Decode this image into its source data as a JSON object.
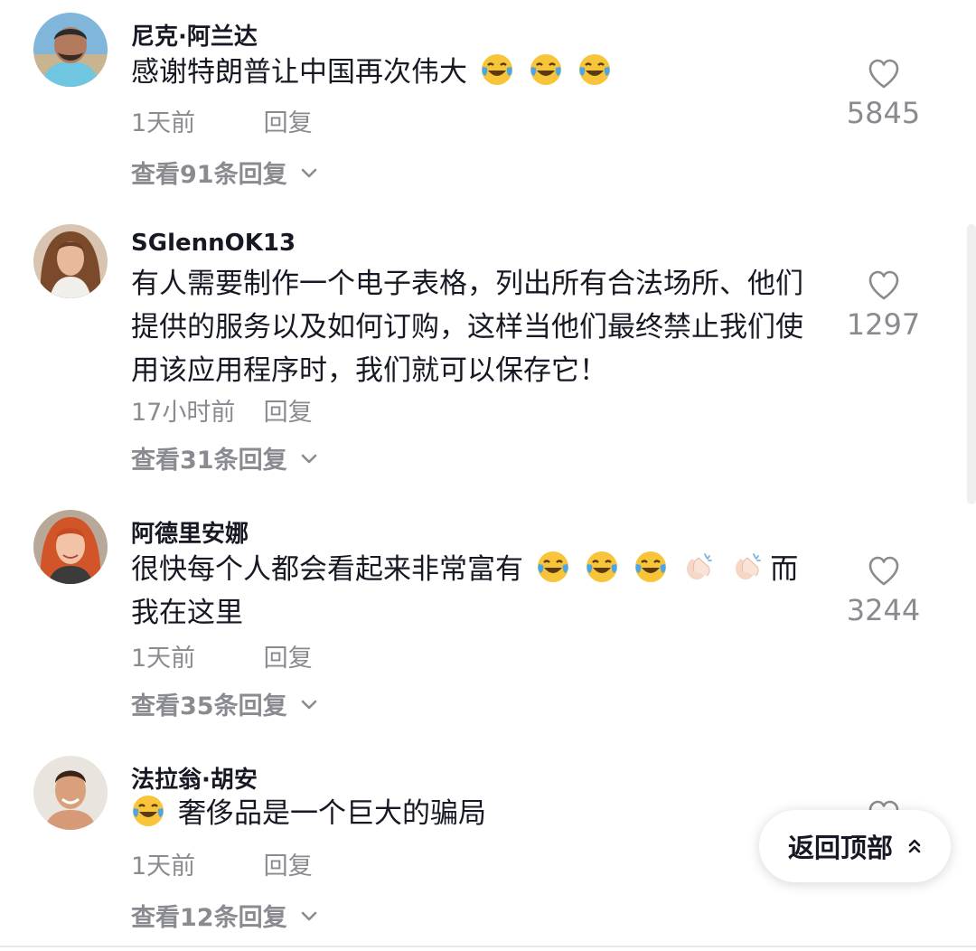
{
  "comments": [
    {
      "username": "尼克·阿兰达",
      "text": "感谢特朗普让中国再次伟大",
      "trailing_emojis": [
        "joy-emoji",
        "joy-emoji",
        "joy-emoji"
      ],
      "time": "1天前",
      "reply_label": "回复",
      "view_replies": "查看91条回复",
      "likes": "5845"
    },
    {
      "username": "SGlennOK13",
      "text": "有人需要制作一个电子表格，列出所有合法场所、他们提供的服务以及如何订购，这样当他们最终禁止我们使用该应用程序时，我们就可以保存它！",
      "time": "17小时前",
      "reply_label": "回复",
      "view_replies": "查看31条回复",
      "likes": "1297"
    },
    {
      "username": "阿德里安娜",
      "text_before": "很快每个人都会看起来非常富有",
      "inline_emojis": [
        "joy-emoji",
        "joy-emoji",
        "joy-emoji",
        "clapping-hands-emoji",
        "clapping-hands-emoji"
      ],
      "text_after": "而我在这里",
      "time": "1天前",
      "reply_label": "回复",
      "view_replies": "查看35条回复",
      "likes": "3244"
    },
    {
      "username": "法拉翁·胡安",
      "leading_emoji": "joy-emoji",
      "text": "奢侈品是一个巨大的骗局",
      "time": "1天前",
      "reply_label": "回复",
      "view_replies": "查看12条回复"
    }
  ],
  "back_to_top": {
    "label": "返回顶部",
    "icon": "double-chevron-up-icon"
  },
  "icons": {
    "like": "heart-outline-icon",
    "expand": "chevron-down-icon"
  },
  "colors": {
    "text_primary": "#161823",
    "text_secondary": "#8a8b91",
    "background": "#ffffff"
  }
}
